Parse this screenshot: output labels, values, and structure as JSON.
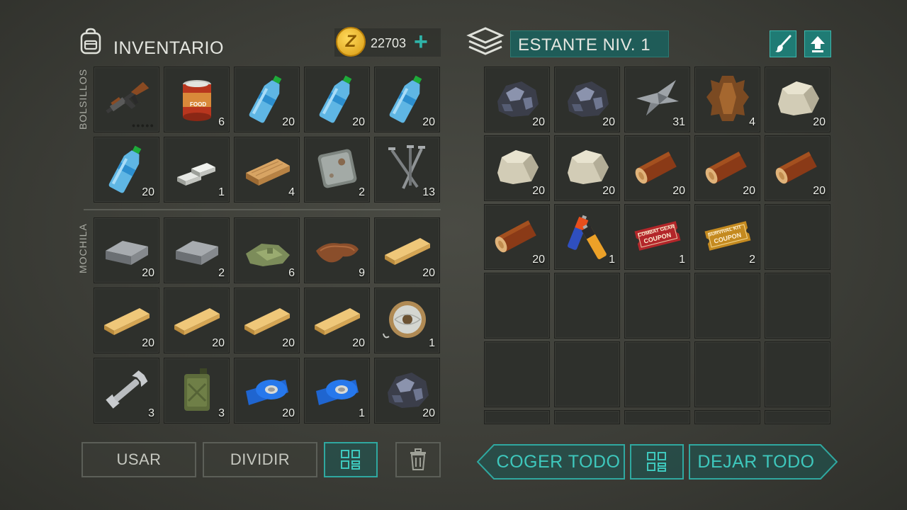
{
  "inventory": {
    "title": "INVENTARIO",
    "coins": "22703",
    "coin_symbol": "Z",
    "pockets_label": "BOLSILLOS",
    "backpack_label": "MOCHILA",
    "pockets": [
      {
        "item": "ak-rifle",
        "count": "",
        "durability_dots": "●●●●●"
      },
      {
        "item": "canned-food",
        "count": "6",
        "label": "FOOD"
      },
      {
        "item": "water-bottle",
        "count": "20"
      },
      {
        "item": "water-bottle",
        "count": "20"
      },
      {
        "item": "water-bottle",
        "count": "20"
      },
      {
        "item": "water-bottle",
        "count": "20"
      },
      {
        "item": "silver-bars",
        "count": "1"
      },
      {
        "item": "wood-plank",
        "count": "4"
      },
      {
        "item": "metal-plate",
        "count": "2"
      },
      {
        "item": "nails",
        "count": "13"
      }
    ],
    "backpack": [
      {
        "item": "iron-bar",
        "count": "20"
      },
      {
        "item": "iron-bar",
        "count": "2"
      },
      {
        "item": "cloth",
        "count": "6"
      },
      {
        "item": "leather",
        "count": "9"
      },
      {
        "item": "wood-board",
        "count": "20"
      },
      {
        "item": "wood-board",
        "count": "20"
      },
      {
        "item": "wood-board",
        "count": "20"
      },
      {
        "item": "wood-board",
        "count": "20"
      },
      {
        "item": "wood-board",
        "count": "20"
      },
      {
        "item": "wire-spool",
        "count": "1"
      },
      {
        "item": "wrench",
        "count": "3"
      },
      {
        "item": "jerrycan",
        "count": "3"
      },
      {
        "item": "tape",
        "count": "20"
      },
      {
        "item": "tape",
        "count": "1"
      },
      {
        "item": "iron-ore",
        "count": "20"
      }
    ],
    "buttons": {
      "use": "USAR",
      "split": "DIVIDIR"
    }
  },
  "storage": {
    "title": "ESTANTE NIV. 1",
    "items": [
      {
        "item": "iron-ore",
        "count": "20"
      },
      {
        "item": "iron-ore",
        "count": "20"
      },
      {
        "item": "scrap-metal",
        "count": "31"
      },
      {
        "item": "animal-hide",
        "count": "4"
      },
      {
        "item": "stone",
        "count": "20"
      },
      {
        "item": "stone",
        "count": "20"
      },
      {
        "item": "stone",
        "count": "20"
      },
      {
        "item": "log",
        "count": "20"
      },
      {
        "item": "log",
        "count": "20"
      },
      {
        "item": "log",
        "count": "20"
      },
      {
        "item": "log",
        "count": "20"
      },
      {
        "item": "batteries",
        "count": "1"
      },
      {
        "item": "coupon-red",
        "count": "1",
        "line1": "COMBAT GEAR",
        "line2": "COUPON"
      },
      {
        "item": "coupon-gold",
        "count": "2",
        "line1": "SURVIVAL KIT",
        "line2": "COUPON"
      }
    ],
    "buttons": {
      "take_all": "COGER TODO",
      "drop_all": "DEJAR TODO"
    }
  },
  "colors": {
    "accent": "#2fa8a0",
    "accent_text": "#3ec8bd",
    "slot_bg": "#2e302c"
  }
}
